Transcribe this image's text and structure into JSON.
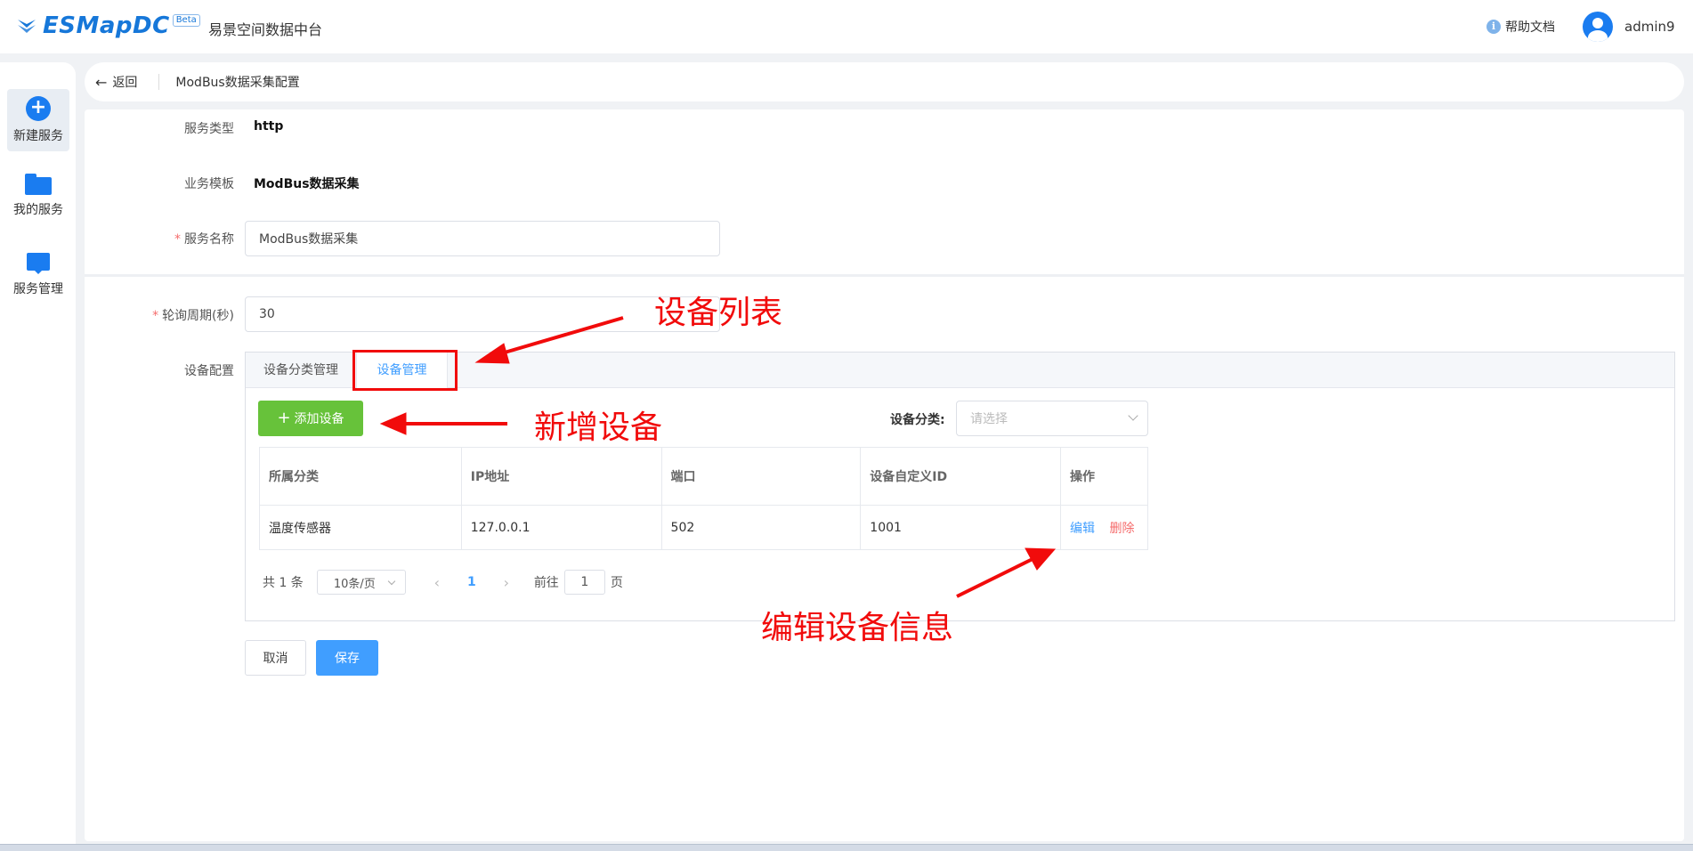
{
  "header": {
    "logo_text": "ESMapDC",
    "logo_badge": "Beta",
    "app_name": "易景空间数据中台",
    "help_label": "帮助文档",
    "username": "admin9"
  },
  "sidebar": {
    "items": [
      {
        "label": "新建服务",
        "icon": "plus-circle-icon",
        "active": true
      },
      {
        "label": "我的服务",
        "icon": "folder-icon",
        "active": false
      },
      {
        "label": "服务管理",
        "icon": "book-icon",
        "active": false
      }
    ]
  },
  "breadcrumb": {
    "back_label": "返回",
    "title": "ModBus数据采集配置"
  },
  "form": {
    "service_type_label": "服务类型",
    "service_type_value": "http",
    "template_label": "业务模板",
    "template_value": "ModBus数据采集",
    "name_label": "服务名称",
    "name_value": "ModBus数据采集",
    "poll_label": "轮询周期(秒)",
    "poll_value": "30",
    "device_config_label": "设备配置",
    "required_mark": "*"
  },
  "device_tabs": [
    {
      "label": "设备分类管理",
      "active": false
    },
    {
      "label": "设备管理",
      "active": true
    }
  ],
  "device_panel": {
    "add_button": "添加设备",
    "add_icon": "+",
    "filter_label": "设备分类:",
    "filter_placeholder": "请选择",
    "table": {
      "headers": [
        "所属分类",
        "IP地址",
        "端口",
        "设备自定义ID",
        "操作"
      ],
      "rows": [
        {
          "category": "温度传感器",
          "ip": "127.0.0.1",
          "port": "502",
          "custom_id": "1001",
          "edit": "编辑",
          "delete": "删除"
        }
      ]
    },
    "pagination": {
      "total": "共 1 条",
      "page_size": "10条/页",
      "current_page": "1",
      "goto_prefix": "前往",
      "goto_value": "1",
      "goto_suffix": "页"
    }
  },
  "actions": {
    "cancel": "取消",
    "save": "保存"
  },
  "annotations": {
    "device_list": "设备列表",
    "add_device": "新增设备",
    "edit_device": "编辑设备信息",
    "color": "#f10b0b"
  },
  "colors": {
    "primary": "#409eff",
    "brand": "#1677d9",
    "success": "#67c23a",
    "danger": "#f56c6c"
  }
}
